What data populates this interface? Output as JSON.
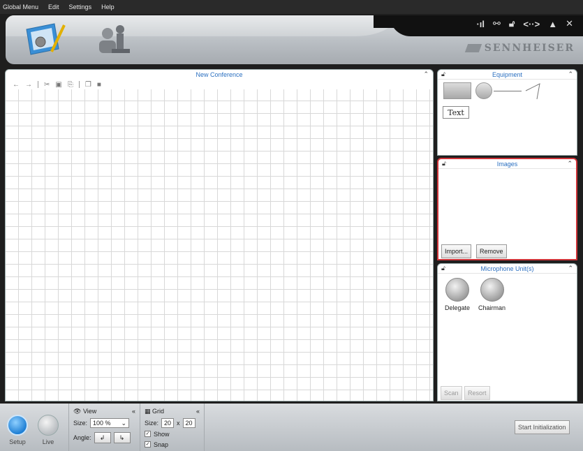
{
  "menu": [
    "Global Menu",
    "Edit",
    "Settings",
    "Help"
  ],
  "header": {
    "brand": "SENNHEISER",
    "tool_icons": [
      "signal-icon",
      "cable-icon",
      "lock-icon",
      "network-icon",
      "eject-icon",
      "close-icon"
    ]
  },
  "canvas": {
    "title": "New Conference",
    "toolbar": [
      "undo-icon",
      "redo-icon",
      "cut-icon",
      "copy-icon",
      "paste-icon",
      "bring-front-icon",
      "send-back-icon"
    ]
  },
  "equipment": {
    "title": "Equipment",
    "text_tool": "Text"
  },
  "images": {
    "title": "Images",
    "import_label": "Import...",
    "remove_label": "Remove"
  },
  "microphones": {
    "title": "Microphone Unit(s)",
    "units": [
      "Delegate",
      "Chairman"
    ],
    "scan_label": "Scan",
    "resort_label": "Resort"
  },
  "bottom": {
    "setup_label": "Setup",
    "live_label": "Live",
    "view": {
      "title": "View",
      "size_label": "Size:",
      "size_value": "100 %",
      "angle_label": "Angle:"
    },
    "grid": {
      "title": "Grid",
      "size_label": "Size:",
      "w": "20",
      "x": "x",
      "h": "20",
      "show_label": "Show",
      "snap_label": "Snap"
    },
    "start_label": "Start Initialization"
  },
  "colors": {
    "accent": "#2a6fc0",
    "highlight": "#d0353a"
  }
}
